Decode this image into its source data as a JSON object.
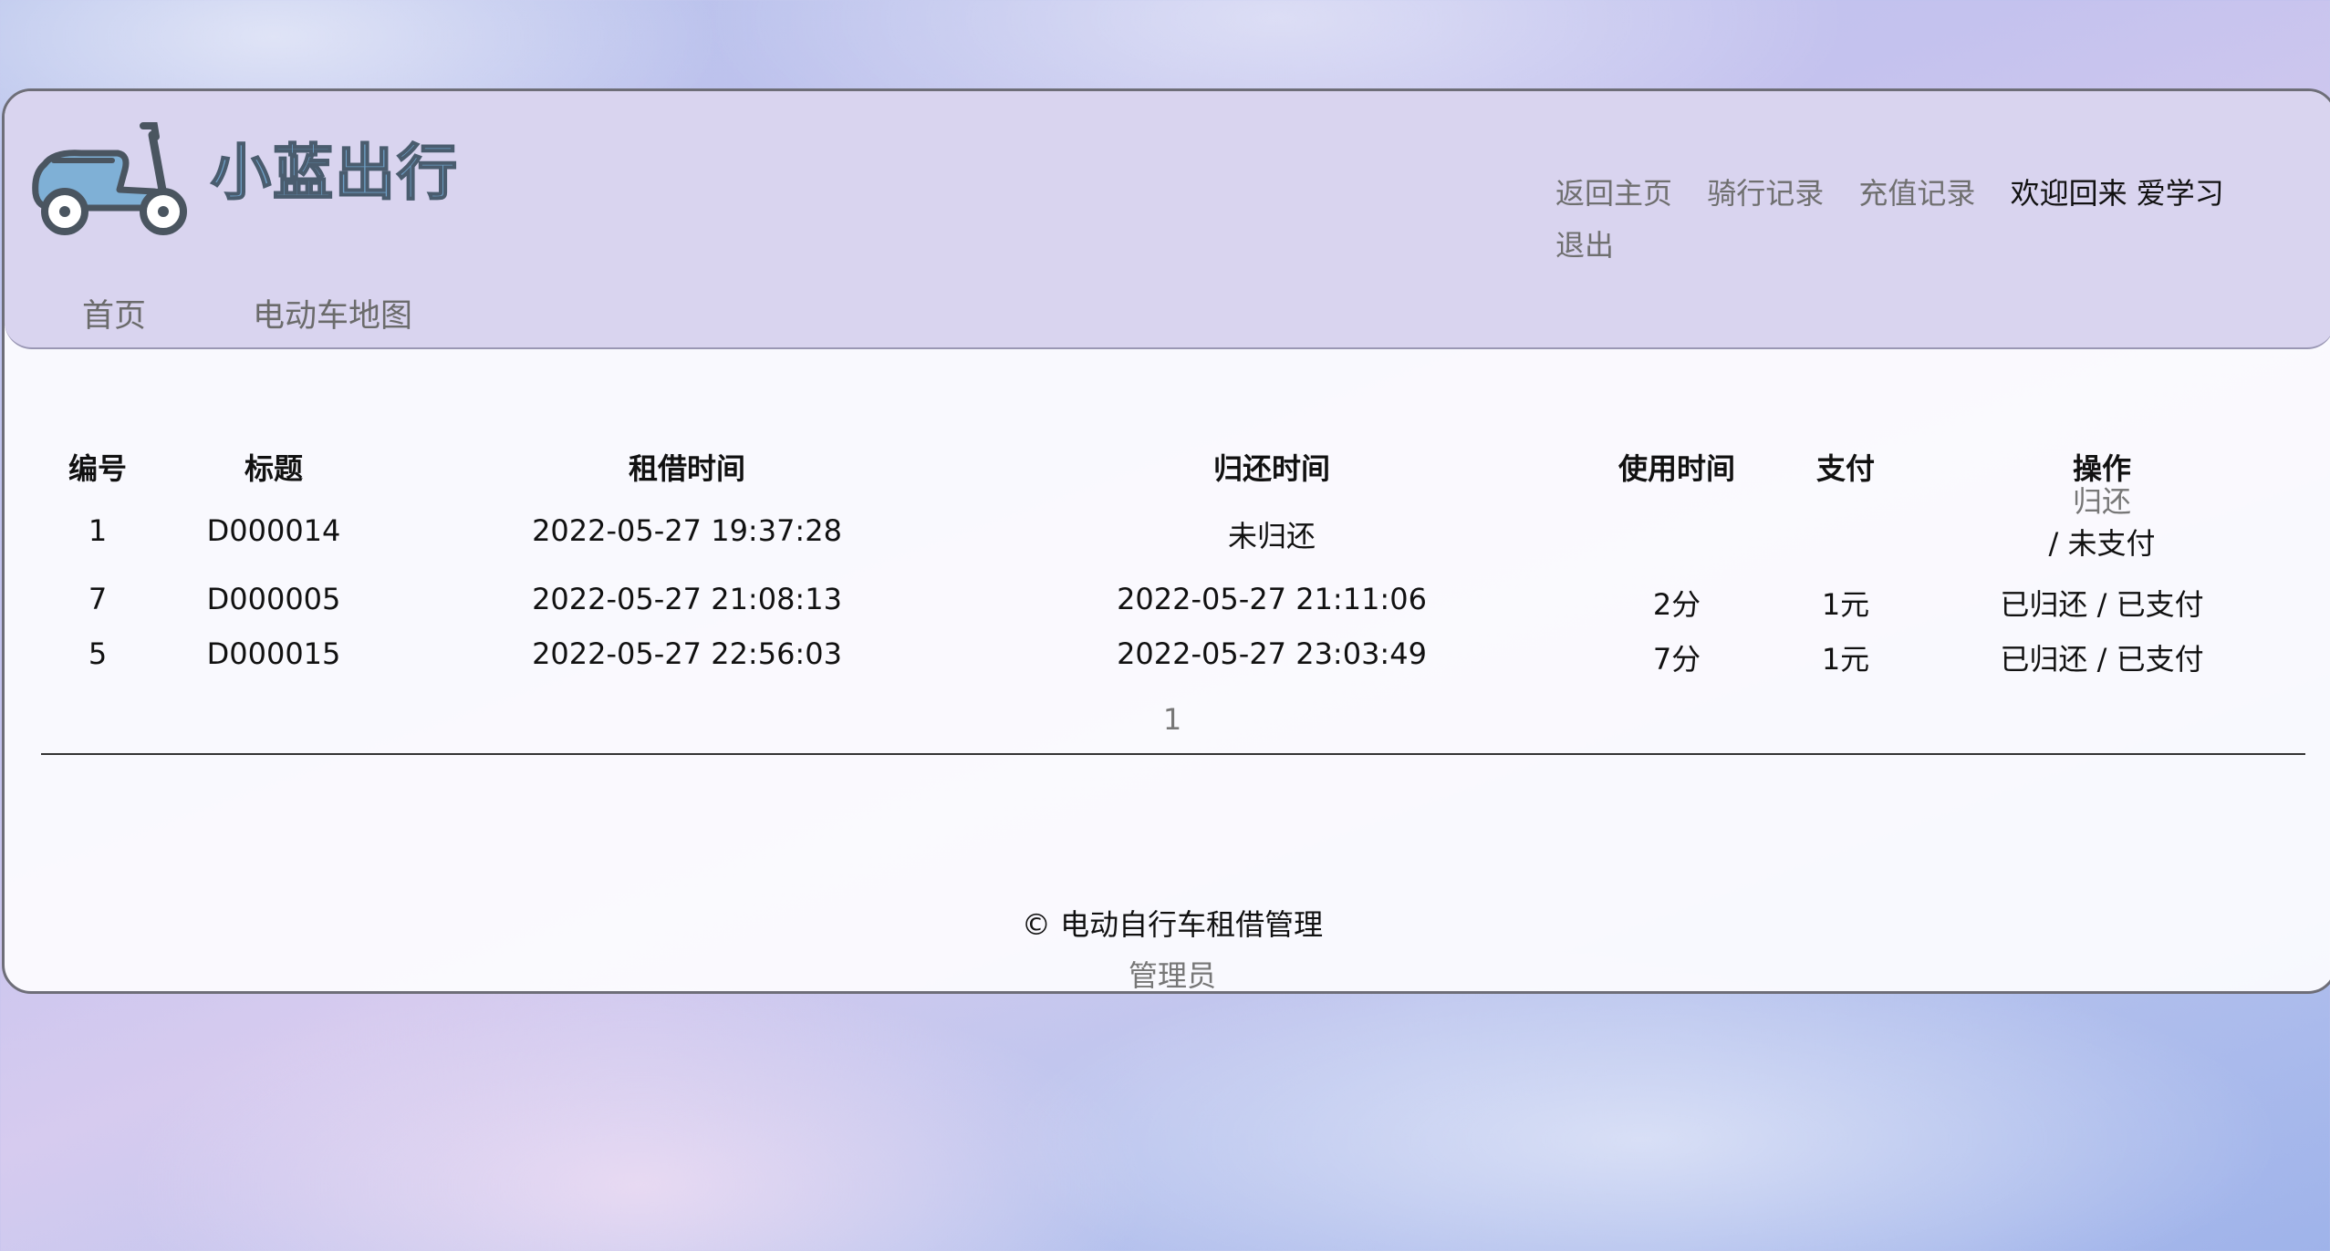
{
  "brand": {
    "name": "小蓝出行",
    "logo_icon": "scooter-icon"
  },
  "topnav": {
    "home": "返回主页",
    "ride_records": "骑行记录",
    "recharge_records": "充值记录",
    "welcome": "欢迎回来 爱学习",
    "logout": "退出"
  },
  "mainnav": {
    "home": "首页",
    "map": "电动车地图"
  },
  "table": {
    "headers": [
      "编号",
      "标题",
      "租借时间",
      "归还时间",
      "使用时间",
      "支付",
      "操作"
    ],
    "rows": [
      {
        "id": "1",
        "title": "D000014",
        "rent_time": "2022-05-27 19:37:28",
        "return_time": "未归还",
        "duration": "",
        "payment": "",
        "op_action": "归还",
        "op_sep": "/",
        "op_pay": "未支付"
      },
      {
        "id": "7",
        "title": "D000005",
        "rent_time": "2022-05-27 21:08:13",
        "return_time": "2022-05-27 21:11:06",
        "duration": "2分",
        "payment": "1元",
        "op_action": "已归还",
        "op_sep": "/",
        "op_pay": "已支付"
      },
      {
        "id": "5",
        "title": "D000015",
        "rent_time": "2022-05-27 22:56:03",
        "return_time": "2022-05-27 23:03:49",
        "duration": "7分",
        "payment": "1元",
        "op_action": "已归还",
        "op_sep": "/",
        "op_pay": "已支付"
      }
    ]
  },
  "pagination": {
    "page": "1"
  },
  "footer": {
    "copyright": "© 电动自行车租借管理",
    "admin": "管理员"
  },
  "colors": {
    "brand": "#6e9fc6",
    "header_bg": "#d6d0ee",
    "link": "#6f6f6f"
  }
}
